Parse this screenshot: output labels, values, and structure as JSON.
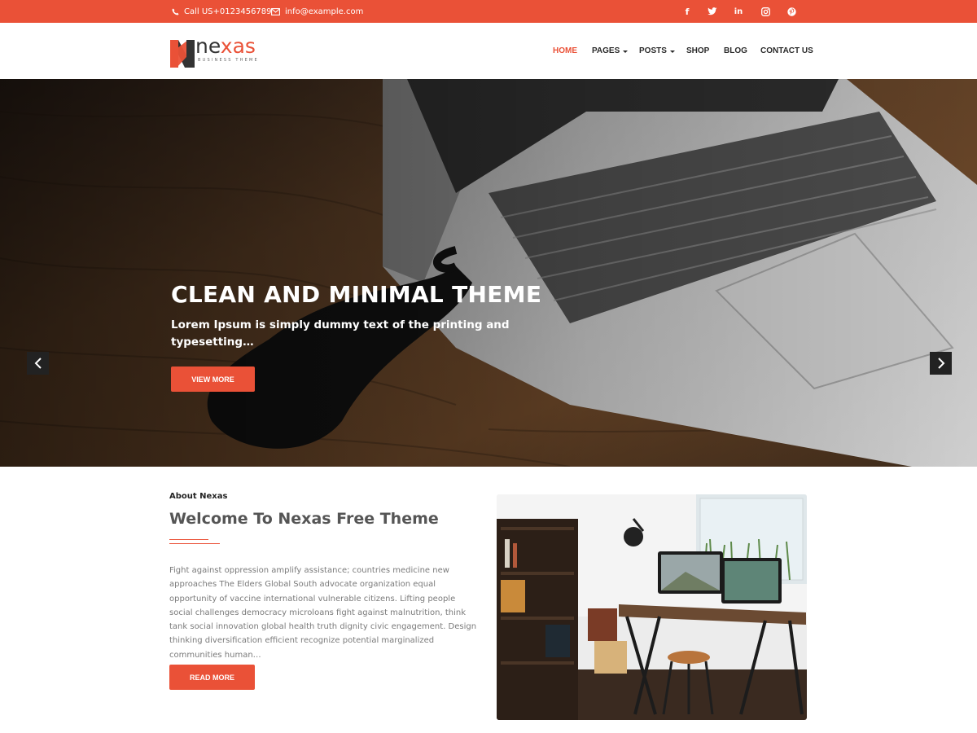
{
  "topbar": {
    "phone": "Call US+0123456789",
    "email": "info@example.com",
    "social": [
      {
        "icon": "facebook-icon",
        "glyph": "f"
      },
      {
        "icon": "twitter-icon",
        "glyph": "t"
      },
      {
        "icon": "linkedin-icon",
        "glyph": "in"
      },
      {
        "icon": "instagram-icon",
        "glyph": "◎"
      },
      {
        "icon": "pinterest-icon",
        "glyph": "℗"
      }
    ]
  },
  "logo": {
    "word_a": "ne",
    "word_b": "xas",
    "tagline": "BUSINESS THEME"
  },
  "nav": {
    "home": "HOME",
    "pages": "PAGES",
    "posts": "POSTS",
    "shop": "SHOP",
    "blog": "BLOG",
    "contact": "CONTACT US"
  },
  "hero": {
    "title": "CLEAN AND MINIMAL THEME",
    "subtitle": "Lorem Ipsum is simply dummy text of the printing and typesetting…",
    "button": "VIEW MORE"
  },
  "about": {
    "eyebrow": "About Nexas",
    "title": "Welcome To Nexas Free Theme",
    "body": "Fight against oppression amplify assistance; countries medicine new approaches The Elders Global South advocate organization equal opportunity of vaccine international vulnerable citizens. Lifting people social challenges democracy microloans fight against malnutrition, think tank social innovation global health truth dignity civic engagement. Design thinking diversification efficient recognize potential marginalized communities human…",
    "button": "READ MORE"
  },
  "colors": {
    "accent": "#ea5137",
    "nav_text": "#2a2a2a",
    "body_text": "#7a7a7a"
  }
}
